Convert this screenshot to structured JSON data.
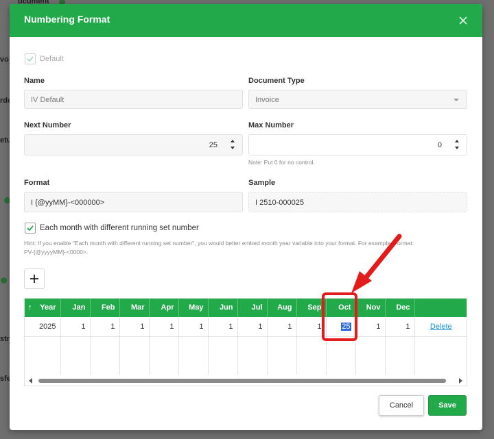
{
  "backdrop": {
    "fragments": [
      "ocument",
      "vo",
      "rde",
      "etu",
      "stn",
      "sfe"
    ]
  },
  "modal": {
    "title": "Numbering Format",
    "close_icon": "close-icon"
  },
  "form": {
    "default_label": "Default",
    "default_checked": true,
    "name_label": "Name",
    "name_value": "IV Default",
    "doc_type_label": "Document Type",
    "doc_type_value": "Invoice",
    "next_number_label": "Next Number",
    "next_number_value": "25",
    "max_number_label": "Max Number",
    "max_number_value": "0",
    "max_note": "Note: Put 0 for no control.",
    "format_label": "Format",
    "format_value": "I {@yyMM}-<000000>",
    "sample_label": "Sample",
    "sample_value": "I 2510-000025",
    "monthly_label": "Each month with different running set number",
    "monthly_checked": true,
    "hint_line1": "Hint: If you enable \"Each month with different running set number\", you would better embed month year variable into your format. For example, Format:",
    "hint_line2": "PV-{@yyyyMM}-<0000>."
  },
  "table": {
    "headers": [
      "Year",
      "Jan",
      "Feb",
      "Mar",
      "Apr",
      "May",
      "Jun",
      "Jul",
      "Aug",
      "Sep",
      "Oct",
      "Nov",
      "Dec"
    ],
    "rows": [
      {
        "year": "2025",
        "months": [
          "1",
          "1",
          "1",
          "1",
          "1",
          "1",
          "1",
          "1",
          "1",
          "25",
          "1",
          "1"
        ],
        "action": "Delete"
      }
    ]
  },
  "buttons": {
    "add_icon": "plus-icon",
    "cancel": "Cancel",
    "save": "Save"
  },
  "colors": {
    "accent": "#22a94a",
    "annotation": "#e31b1b",
    "link": "#1a8fd6"
  }
}
